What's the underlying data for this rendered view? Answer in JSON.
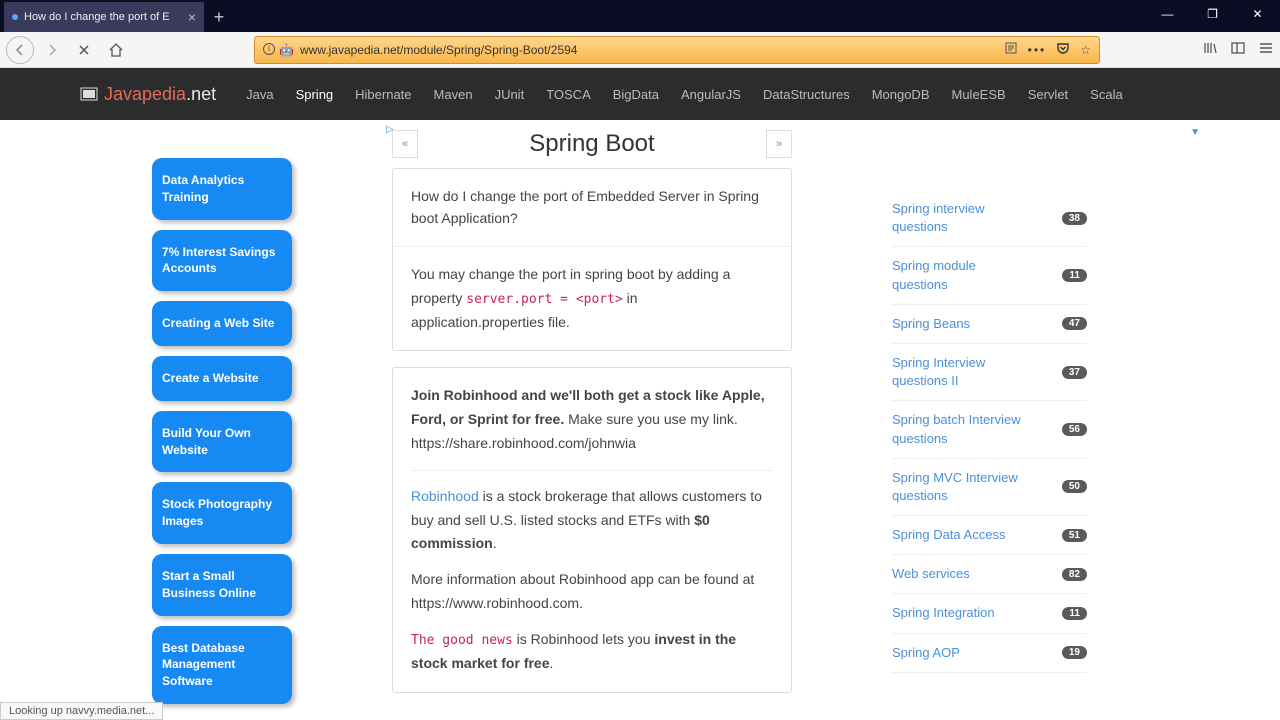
{
  "browser": {
    "tab_title": "How do I change the port of E",
    "url": "www.javapedia.net/module/Spring/Spring-Boot/2594",
    "status": "Looking up navvy.media.net..."
  },
  "nav": {
    "brand_java": "Javapedia",
    "brand_net": ".net",
    "items": [
      "Java",
      "Spring",
      "Hibernate",
      "Maven",
      "JUnit",
      "TOSCA",
      "BigData",
      "AngularJS",
      "DataStructures",
      "MongoDB",
      "MuleESB",
      "Servlet",
      "Scala"
    ],
    "active_index": 1
  },
  "ads": [
    "Data Analytics Training",
    "7% Interest Savings Accounts",
    "Creating a Web Site",
    "Create a Website",
    "Build Your Own Website",
    "Stock Photography Images",
    "Start a Small Business Online",
    "Best Database Management Software"
  ],
  "main": {
    "page_title": "Spring Boot",
    "prev": "«",
    "next": "»",
    "question": "How do I change the port of Embedded Server in Spring boot Application?",
    "answer_pre": "You may change the port in spring boot by adding a property ",
    "answer_code": "server.port = <port>",
    "answer_post": " in application.properties file.",
    "promo_head_bold": "Join Robinhood and we'll both get a stock like Apple, Ford, or Sprint for free.",
    "promo_head_rest": " Make sure you use my link. https://share.robinhood.com/johnwia",
    "promo_p1_link": "Robinhood",
    "promo_p1_a": " is a stock brokerage that allows customers to buy and sell U.S. listed stocks and ETFs with ",
    "promo_p1_bold": "$0 commission",
    "promo_p1_end": ".",
    "promo_p2": "More information about Robinhood app can be found at https://www.robinhood.com.",
    "promo_p3_code": "The good news",
    "promo_p3_a": " is Robinhood lets you ",
    "promo_p3_bold": "invest in the stock market for free",
    "promo_p3_end": "."
  },
  "sidebar": [
    {
      "label": "Spring interview questions",
      "count": "38"
    },
    {
      "label": "Spring module questions",
      "count": "11"
    },
    {
      "label": "Spring Beans",
      "count": "47"
    },
    {
      "label": "Spring Interview questions II",
      "count": "37"
    },
    {
      "label": "Spring batch Interview questions",
      "count": "56"
    },
    {
      "label": "Spring MVC Interview questions",
      "count": "50"
    },
    {
      "label": "Spring Data Access",
      "count": "51"
    },
    {
      "label": "Web services",
      "count": "82"
    },
    {
      "label": "Spring Integration",
      "count": "11"
    },
    {
      "label": "Spring AOP",
      "count": "19"
    }
  ]
}
